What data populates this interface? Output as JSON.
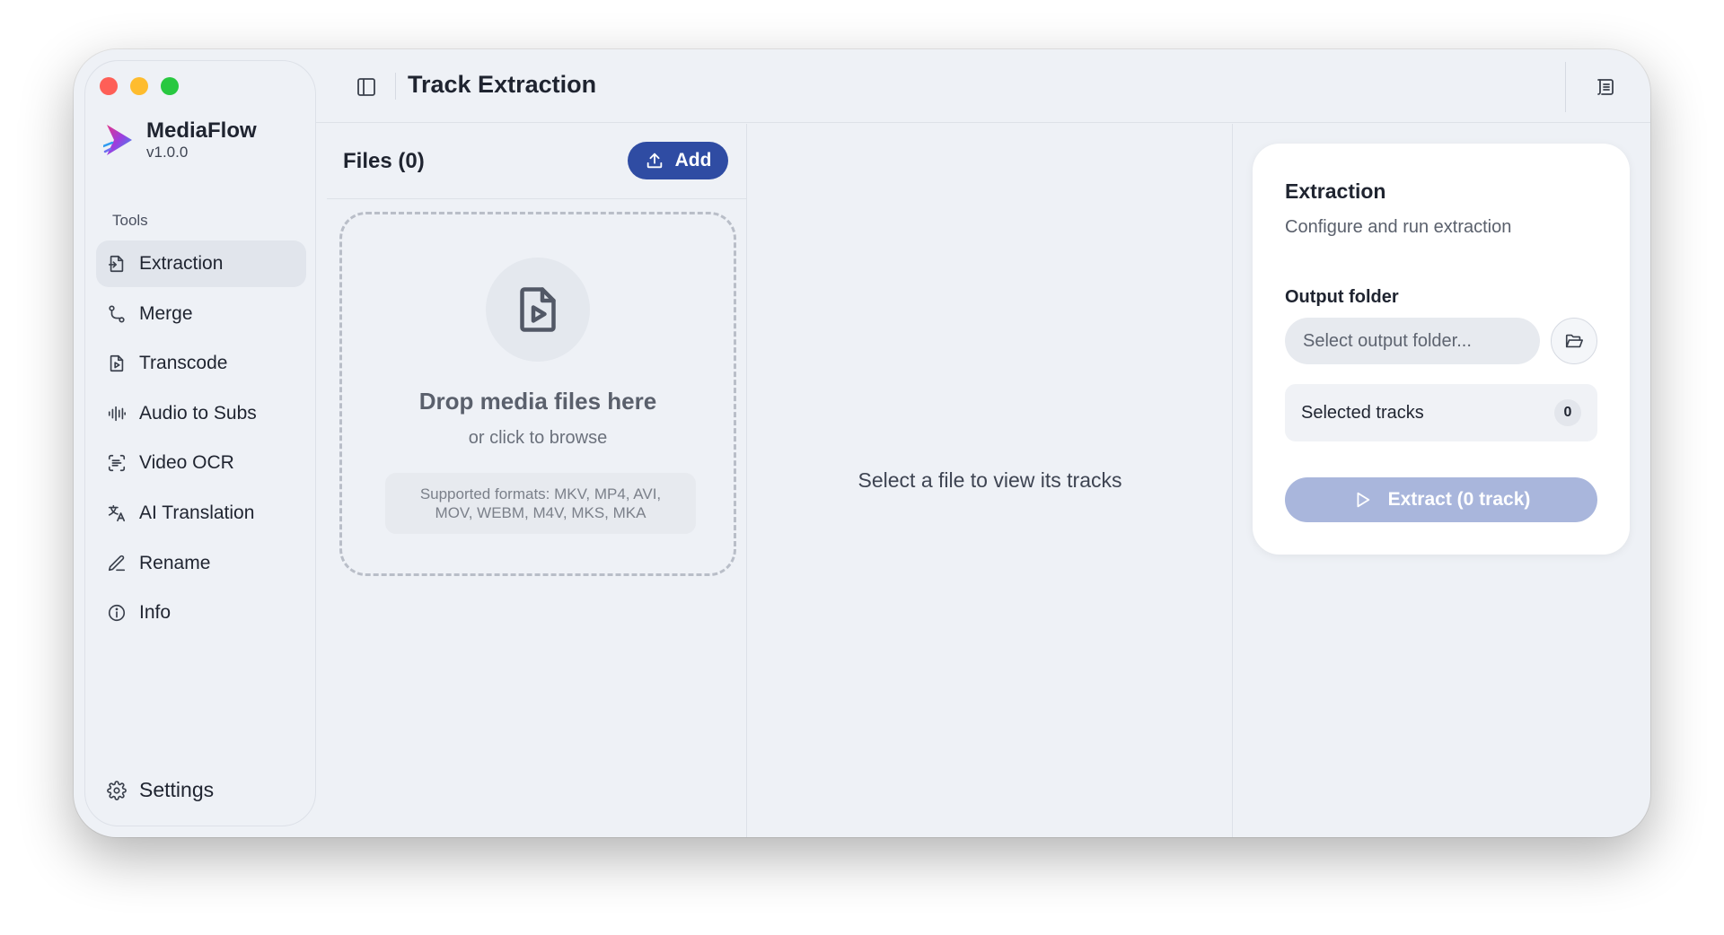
{
  "app": {
    "name": "MediaFlow",
    "version": "v1.0.0",
    "accent_color": "#2f4ca3"
  },
  "sidebar": {
    "section_label": "Tools",
    "items": [
      {
        "label": "Extraction",
        "icon": "file-export-icon",
        "active": true
      },
      {
        "label": "Merge",
        "icon": "merge-icon",
        "active": false
      },
      {
        "label": "Transcode",
        "icon": "file-video-icon",
        "active": false
      },
      {
        "label": "Audio to Subs",
        "icon": "audio-lines-icon",
        "active": false
      },
      {
        "label": "Video OCR",
        "icon": "scan-text-icon",
        "active": false
      },
      {
        "label": "AI Translation",
        "icon": "translate-icon",
        "active": false
      },
      {
        "label": "Rename",
        "icon": "pen-icon",
        "active": false
      },
      {
        "label": "Info",
        "icon": "info-icon",
        "active": false
      }
    ],
    "settings_label": "Settings"
  },
  "header": {
    "title": "Track Extraction"
  },
  "files": {
    "title": "Files (0)",
    "add_label": "Add",
    "dropzone": {
      "title": "Drop media files here",
      "subtitle": "or click to browse",
      "formats": "Supported formats: MKV, MP4, AVI, MOV, WEBM, M4V, MKS, MKA"
    }
  },
  "tracks": {
    "empty_message": "Select a file to view its tracks"
  },
  "extraction": {
    "title": "Extraction",
    "subtitle": "Configure and run extraction",
    "output_label": "Output folder",
    "output_placeholder": "Select output folder...",
    "selected_label": "Selected tracks",
    "selected_count": "0",
    "extract_label": "Extract (0 track)"
  }
}
